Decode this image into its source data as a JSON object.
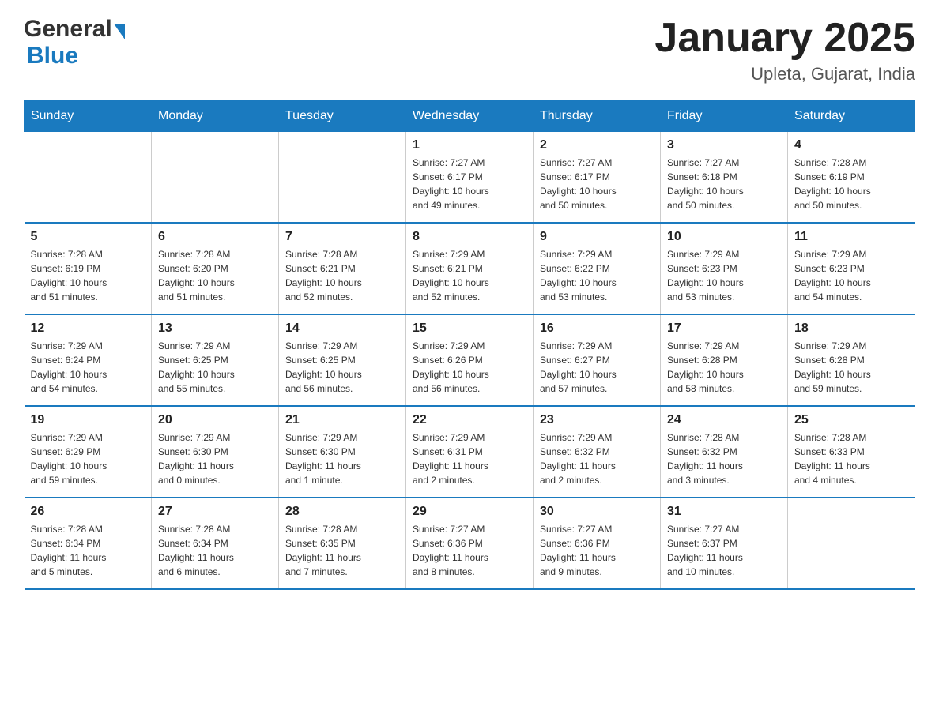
{
  "header": {
    "logo_general": "General",
    "logo_blue": "Blue",
    "title": "January 2025",
    "subtitle": "Upleta, Gujarat, India"
  },
  "weekdays": [
    "Sunday",
    "Monday",
    "Tuesday",
    "Wednesday",
    "Thursday",
    "Friday",
    "Saturday"
  ],
  "weeks": [
    [
      {
        "day": "",
        "info": ""
      },
      {
        "day": "",
        "info": ""
      },
      {
        "day": "",
        "info": ""
      },
      {
        "day": "1",
        "info": "Sunrise: 7:27 AM\nSunset: 6:17 PM\nDaylight: 10 hours\nand 49 minutes."
      },
      {
        "day": "2",
        "info": "Sunrise: 7:27 AM\nSunset: 6:17 PM\nDaylight: 10 hours\nand 50 minutes."
      },
      {
        "day": "3",
        "info": "Sunrise: 7:27 AM\nSunset: 6:18 PM\nDaylight: 10 hours\nand 50 minutes."
      },
      {
        "day": "4",
        "info": "Sunrise: 7:28 AM\nSunset: 6:19 PM\nDaylight: 10 hours\nand 50 minutes."
      }
    ],
    [
      {
        "day": "5",
        "info": "Sunrise: 7:28 AM\nSunset: 6:19 PM\nDaylight: 10 hours\nand 51 minutes."
      },
      {
        "day": "6",
        "info": "Sunrise: 7:28 AM\nSunset: 6:20 PM\nDaylight: 10 hours\nand 51 minutes."
      },
      {
        "day": "7",
        "info": "Sunrise: 7:28 AM\nSunset: 6:21 PM\nDaylight: 10 hours\nand 52 minutes."
      },
      {
        "day": "8",
        "info": "Sunrise: 7:29 AM\nSunset: 6:21 PM\nDaylight: 10 hours\nand 52 minutes."
      },
      {
        "day": "9",
        "info": "Sunrise: 7:29 AM\nSunset: 6:22 PM\nDaylight: 10 hours\nand 53 minutes."
      },
      {
        "day": "10",
        "info": "Sunrise: 7:29 AM\nSunset: 6:23 PM\nDaylight: 10 hours\nand 53 minutes."
      },
      {
        "day": "11",
        "info": "Sunrise: 7:29 AM\nSunset: 6:23 PM\nDaylight: 10 hours\nand 54 minutes."
      }
    ],
    [
      {
        "day": "12",
        "info": "Sunrise: 7:29 AM\nSunset: 6:24 PM\nDaylight: 10 hours\nand 54 minutes."
      },
      {
        "day": "13",
        "info": "Sunrise: 7:29 AM\nSunset: 6:25 PM\nDaylight: 10 hours\nand 55 minutes."
      },
      {
        "day": "14",
        "info": "Sunrise: 7:29 AM\nSunset: 6:25 PM\nDaylight: 10 hours\nand 56 minutes."
      },
      {
        "day": "15",
        "info": "Sunrise: 7:29 AM\nSunset: 6:26 PM\nDaylight: 10 hours\nand 56 minutes."
      },
      {
        "day": "16",
        "info": "Sunrise: 7:29 AM\nSunset: 6:27 PM\nDaylight: 10 hours\nand 57 minutes."
      },
      {
        "day": "17",
        "info": "Sunrise: 7:29 AM\nSunset: 6:28 PM\nDaylight: 10 hours\nand 58 minutes."
      },
      {
        "day": "18",
        "info": "Sunrise: 7:29 AM\nSunset: 6:28 PM\nDaylight: 10 hours\nand 59 minutes."
      }
    ],
    [
      {
        "day": "19",
        "info": "Sunrise: 7:29 AM\nSunset: 6:29 PM\nDaylight: 10 hours\nand 59 minutes."
      },
      {
        "day": "20",
        "info": "Sunrise: 7:29 AM\nSunset: 6:30 PM\nDaylight: 11 hours\nand 0 minutes."
      },
      {
        "day": "21",
        "info": "Sunrise: 7:29 AM\nSunset: 6:30 PM\nDaylight: 11 hours\nand 1 minute."
      },
      {
        "day": "22",
        "info": "Sunrise: 7:29 AM\nSunset: 6:31 PM\nDaylight: 11 hours\nand 2 minutes."
      },
      {
        "day": "23",
        "info": "Sunrise: 7:29 AM\nSunset: 6:32 PM\nDaylight: 11 hours\nand 2 minutes."
      },
      {
        "day": "24",
        "info": "Sunrise: 7:28 AM\nSunset: 6:32 PM\nDaylight: 11 hours\nand 3 minutes."
      },
      {
        "day": "25",
        "info": "Sunrise: 7:28 AM\nSunset: 6:33 PM\nDaylight: 11 hours\nand 4 minutes."
      }
    ],
    [
      {
        "day": "26",
        "info": "Sunrise: 7:28 AM\nSunset: 6:34 PM\nDaylight: 11 hours\nand 5 minutes."
      },
      {
        "day": "27",
        "info": "Sunrise: 7:28 AM\nSunset: 6:34 PM\nDaylight: 11 hours\nand 6 minutes."
      },
      {
        "day": "28",
        "info": "Sunrise: 7:28 AM\nSunset: 6:35 PM\nDaylight: 11 hours\nand 7 minutes."
      },
      {
        "day": "29",
        "info": "Sunrise: 7:27 AM\nSunset: 6:36 PM\nDaylight: 11 hours\nand 8 minutes."
      },
      {
        "day": "30",
        "info": "Sunrise: 7:27 AM\nSunset: 6:36 PM\nDaylight: 11 hours\nand 9 minutes."
      },
      {
        "day": "31",
        "info": "Sunrise: 7:27 AM\nSunset: 6:37 PM\nDaylight: 11 hours\nand 10 minutes."
      },
      {
        "day": "",
        "info": ""
      }
    ]
  ]
}
